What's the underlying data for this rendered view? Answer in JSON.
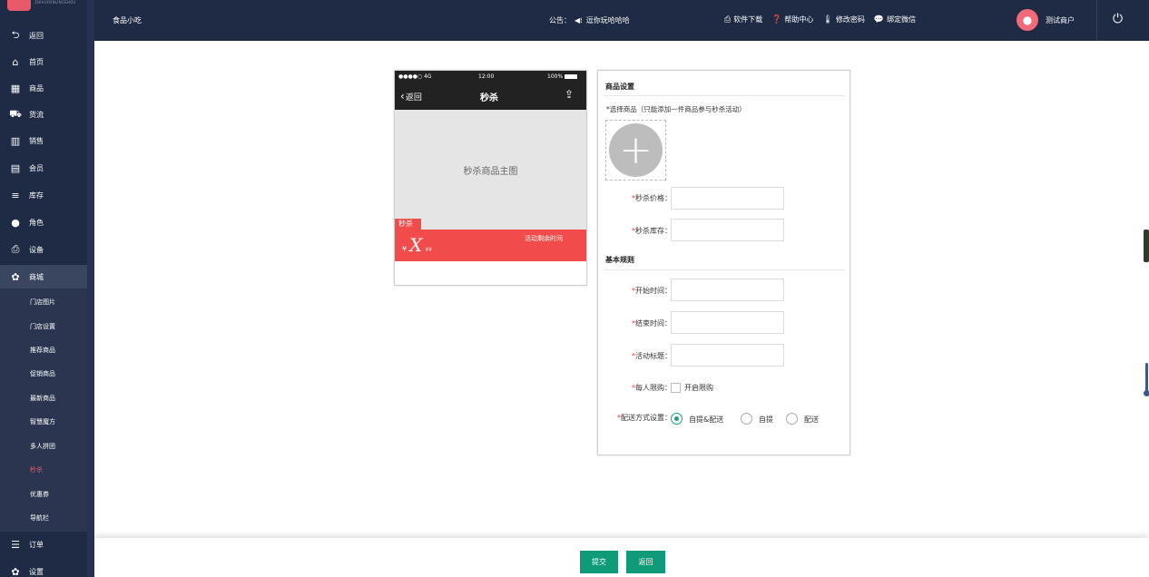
{
  "sidebar": {
    "logo_sub": "ZHIHUIXINLINGSHOU",
    "items": [
      {
        "label": "返回",
        "icon": "back-arrow-icon",
        "glyph": "⮌"
      },
      {
        "label": "首页",
        "icon": "home-icon",
        "glyph": "⌂"
      },
      {
        "label": "商品",
        "icon": "grid-icon",
        "glyph": "▦"
      },
      {
        "label": "货流",
        "icon": "truck-icon",
        "glyph": "⛟"
      },
      {
        "label": "销售",
        "icon": "bar-chart-icon",
        "glyph": "▥"
      },
      {
        "label": "会员",
        "icon": "id-card-icon",
        "glyph": "▤"
      },
      {
        "label": "库存",
        "icon": "database-icon",
        "glyph": "≡"
      },
      {
        "label": "角色",
        "icon": "user-icon",
        "glyph": "●"
      },
      {
        "label": "设备",
        "icon": "printer-icon",
        "glyph": "⎙"
      },
      {
        "label": "商城",
        "icon": "gear-icon",
        "glyph": "✿"
      },
      {
        "label": "订单",
        "icon": "list-icon",
        "glyph": "☰"
      },
      {
        "label": "设置",
        "icon": "settings-icon",
        "glyph": "✿"
      }
    ],
    "submenu": [
      "门店图片",
      "门店设置",
      "推荐商品",
      "促销商品",
      "最新商品",
      "智慧魔方",
      "多人拼团",
      "秒杀",
      "优惠券",
      "导航栏"
    ]
  },
  "topbar": {
    "store_name": "食品小吃",
    "notice_label": "公告：",
    "notice_text": "逗你玩哈哈哈",
    "links": [
      "软件下载",
      "帮助中心",
      "修改密码",
      "绑定微信"
    ],
    "user_name": "测试商户"
  },
  "phone": {
    "signal": "●●●●○ 4G",
    "time": "12:00",
    "battery": "100%",
    "back": "返回",
    "title": "秒杀",
    "main_image": "秒杀商品主图",
    "tag": "秒杀",
    "currency": "¥",
    "price_big": "X",
    "price_small": "¥¥",
    "remain": "活动剩余时间"
  },
  "form": {
    "section1": "商品设置",
    "hint": "*选择商品（只能添加一件商品参与秒杀活动）",
    "upload_plus": "+",
    "price_label": "秒杀价格：",
    "stock_label": "秒杀库存：",
    "section2": "基本规则",
    "start_label": "开始时间：",
    "end_label": "结束时间：",
    "title_label": "活动标题：",
    "limit_label": "每人限购：",
    "limit_option": "开启限购",
    "delivery_label": "配送方式设置：",
    "delivery_options": [
      "自提&配送",
      "自提",
      "配送"
    ],
    "delivery_selected": "自提&配送"
  },
  "actions": {
    "submit": "提交",
    "back": "返回"
  }
}
